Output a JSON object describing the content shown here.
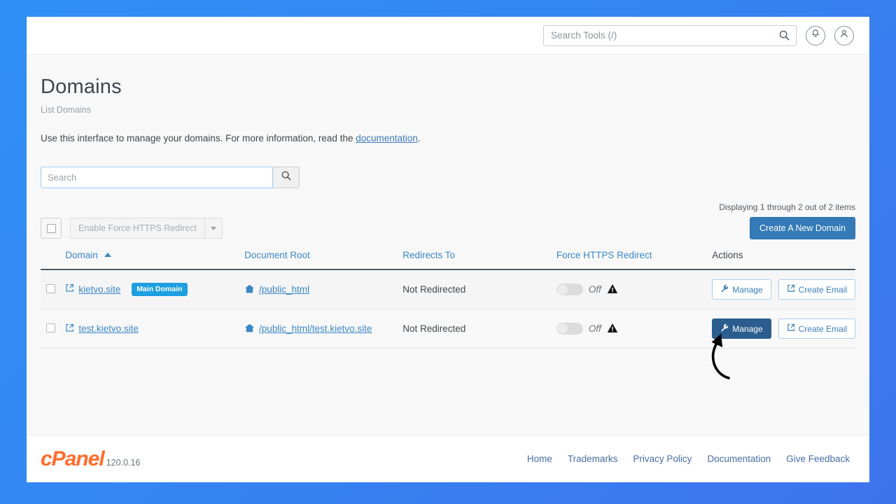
{
  "topbar": {
    "search_placeholder": "Search Tools (/)",
    "search_value": "",
    "search_icon": "search-icon",
    "notifications_icon": "bell-icon",
    "account_icon": "user-icon"
  },
  "header": {
    "title": "Domains",
    "subtitle": "List Domains",
    "intro_before": "Use this interface to manage your domains. For more information, read the ",
    "intro_link": "documentation",
    "intro_after": "."
  },
  "search": {
    "placeholder": "Search",
    "value": "",
    "button_icon": "search-icon"
  },
  "toolbar": {
    "counts": "Displaying 1 through 2 out of 2 items",
    "bulk_action_label": "Enable Force HTTPS Redirect",
    "bulk_caret_icon": "chevron-down-icon",
    "create_button": "Create A New Domain",
    "create_button_color": "#337ab7"
  },
  "table": {
    "columns": [
      {
        "label": "Domain",
        "sorted": true,
        "sort_icon": "caret-up-icon"
      },
      {
        "label": "Document Root",
        "sorted": false
      },
      {
        "label": "Redirects To",
        "sorted": false
      },
      {
        "label": "Force HTTPS Redirect",
        "sorted": false
      },
      {
        "label": "Actions",
        "sorted": false
      }
    ],
    "rows": [
      {
        "domain": "kietvo.site",
        "domain_icon": "external-link-icon",
        "badge": "Main Domain",
        "badge_color": "#1e9fe0",
        "document_root": "/public_html",
        "root_icon": "home-icon",
        "redirects_to": "Not Redirected",
        "force_https": "Off",
        "force_https_warning_icon": "warning-triangle-icon",
        "manage_label": "Manage",
        "manage_icon": "wrench-icon",
        "manage_active": false,
        "create_email_label": "Create Email",
        "create_email_icon": "external-link-icon"
      },
      {
        "domain": "test.kietvo.site",
        "domain_icon": "external-link-icon",
        "badge": "",
        "document_root": "/public_html/test.kietvo.site",
        "root_icon": "home-icon",
        "redirects_to": "Not Redirected",
        "force_https": "Off",
        "force_https_warning_icon": "warning-triangle-icon",
        "manage_label": "Manage",
        "manage_icon": "wrench-icon",
        "manage_active": true,
        "create_email_label": "Create Email",
        "create_email_icon": "external-link-icon"
      }
    ]
  },
  "footer": {
    "logo_text": "cPanel",
    "version": "120.0.16",
    "links": [
      "Home",
      "Trademarks",
      "Privacy Policy",
      "Documentation",
      "Give Feedback"
    ]
  },
  "annotation": {
    "arrow_icon": "curved-arrow-icon",
    "points_to": "manage-button-row-2"
  }
}
